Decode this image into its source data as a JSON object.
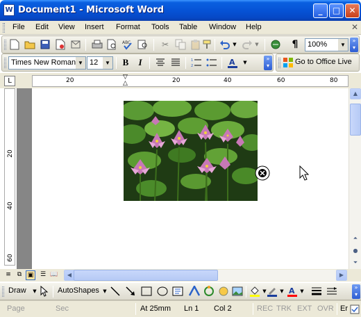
{
  "window": {
    "title": "Document1 - Microsoft Word",
    "app_icon_letter": "W",
    "controls": [
      "minimize",
      "maximize",
      "close"
    ]
  },
  "menubar": {
    "items": [
      {
        "label": "File",
        "key": "F"
      },
      {
        "label": "Edit",
        "key": "E"
      },
      {
        "label": "View",
        "key": "V"
      },
      {
        "label": "Insert",
        "key": "I"
      },
      {
        "label": "Format",
        "key": "o"
      },
      {
        "label": "Tools",
        "key": "T"
      },
      {
        "label": "Table",
        "key": "a"
      },
      {
        "label": "Window",
        "key": "W"
      },
      {
        "label": "Help",
        "key": "H"
      }
    ]
  },
  "standard_toolbar": {
    "zoom": "100%",
    "icons": [
      "new-icon",
      "open-icon",
      "save-icon",
      "permission-icon",
      "email-icon",
      "print-icon",
      "print-preview-icon",
      "spelling-icon",
      "research-icon",
      "cut-icon",
      "copy-icon",
      "format-painter-icon",
      "undo-icon",
      "redo-icon",
      "ink-icon",
      "show-hide-icon"
    ]
  },
  "formatting_toolbar": {
    "font_name": "Times New Roman",
    "font_size": "12",
    "bold": "B",
    "italic": "I",
    "office_live": "Go to Office Live"
  },
  "ruler": {
    "labels": [
      "20",
      "20",
      "40",
      "60",
      "80"
    ],
    "corner_symbol": "L"
  },
  "vertical_ruler": {
    "labels": [
      "20",
      "40",
      "60"
    ]
  },
  "drawing_toolbar": {
    "draw_label": "Draw",
    "autoshapes_label": "AutoShapes"
  },
  "statusbar": {
    "page": "Page",
    "sec": "Sec",
    "at": "At 25mm",
    "ln": "Ln 1",
    "col": "Col 2",
    "rec": "REC",
    "trk": "TRK",
    "ext": "EXT",
    "ovr": "OVR",
    "lang": "Er"
  },
  "colors": {
    "titlebar": "#0653d6",
    "chrome": "#ece9d8",
    "workspace": "#868686",
    "highlight": "#ffff00",
    "font_color": "#ff0000"
  }
}
